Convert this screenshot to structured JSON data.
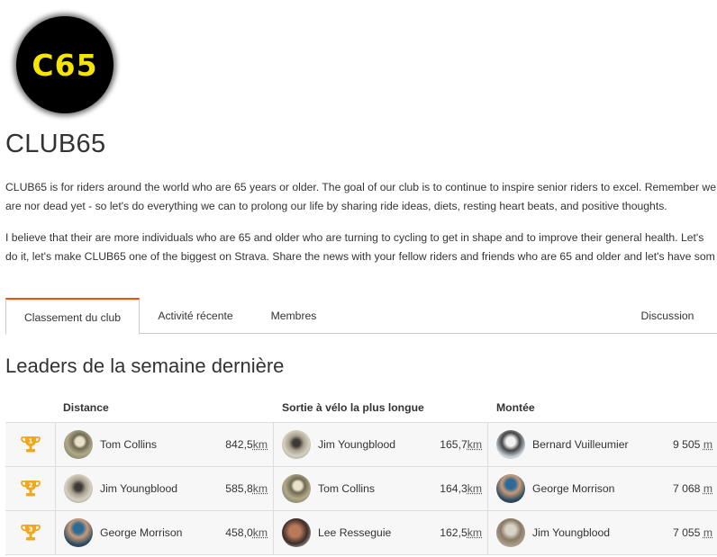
{
  "club": {
    "logo_text": "C65",
    "name": "CLUB65",
    "description_1": "CLUB65 is for riders around the world who are 65 years or older. The goal of our club is to continue to inspire senior riders to excel. Remember we are nor dead yet - so let's do everything we can to prolong our life by sharing ride ideas, diets, resting heart beats, and positive thoughts.",
    "description_2": "I believe that their are more individuals who are 65 and older who are turning to cycling to get in shape and to improve their general health. Let's do it, let's make CLUB65 one of the biggest on Strava. Share the news with your fellow riders and friends who are 65 and older and let's have som"
  },
  "tabs": [
    {
      "label": "Classement du club",
      "active": true
    },
    {
      "label": "Activité récente",
      "active": false
    },
    {
      "label": "Membres",
      "active": false
    },
    {
      "label": "Discussion",
      "active": false
    }
  ],
  "leaderboard": {
    "title": "Leaders de la semaine dernière",
    "columns": [
      "Distance",
      "Sortie à vélo la plus longue",
      "Montée"
    ],
    "rows": [
      {
        "rank": "1",
        "entries": [
          {
            "name": "Tom Collins",
            "value": "842,5",
            "unit": "km"
          },
          {
            "name": "Jim Youngblood",
            "value": "165,7",
            "unit": "km"
          },
          {
            "name": "Bernard Vuilleumier",
            "value": "9 505",
            "unit": "m"
          }
        ]
      },
      {
        "rank": "2",
        "entries": [
          {
            "name": "Jim Youngblood",
            "value": "585,8",
            "unit": "km"
          },
          {
            "name": "Tom Collins",
            "value": "164,3",
            "unit": "km"
          },
          {
            "name": "George Morrison",
            "value": "7 068",
            "unit": "m"
          }
        ]
      },
      {
        "rank": "3",
        "entries": [
          {
            "name": "George Morrison",
            "value": "458,0",
            "unit": "km"
          },
          {
            "name": "Lee Resseguie",
            "value": "162,5",
            "unit": "km"
          },
          {
            "name": "Jim Youngblood",
            "value": "7 055",
            "unit": "m"
          }
        ]
      }
    ]
  },
  "colors": {
    "accent": "#fc4c02",
    "trophy": "#f0a81e"
  },
  "icons": {
    "trophy": "trophy-icon"
  }
}
